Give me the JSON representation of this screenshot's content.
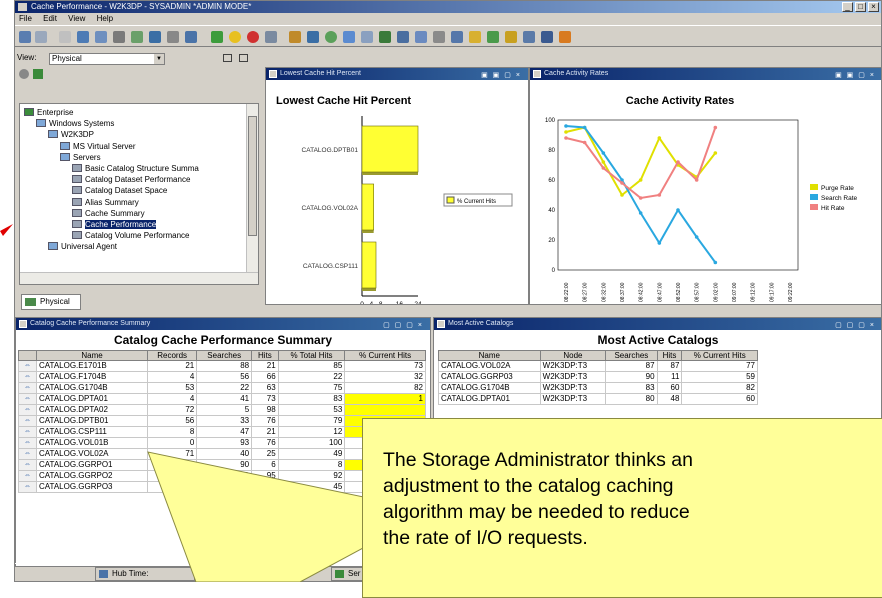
{
  "window": {
    "title": "Cache Performance - W2K3DP - SYSADMIN *ADMIN MODE*",
    "controls": [
      "_",
      "□",
      "×"
    ]
  },
  "menu": [
    "File",
    "Edit",
    "View",
    "Help"
  ],
  "navigator": {
    "view_label": "View:",
    "view_value": "Physical",
    "tab_label": "Physical",
    "tree": [
      {
        "label": "Enterprise",
        "depth": 0,
        "icon": "enterprise-icon"
      },
      {
        "label": "Windows Systems",
        "depth": 1,
        "icon": "folder-icon"
      },
      {
        "label": "W2K3DP",
        "depth": 2,
        "icon": "computer-icon"
      },
      {
        "label": "MS Virtual Server",
        "depth": 3,
        "icon": "agent-icon"
      },
      {
        "label": "Servers",
        "depth": 3,
        "icon": "agent-icon"
      },
      {
        "label": "Basic Catalog Structure Summa",
        "depth": 4,
        "icon": "workspace-icon"
      },
      {
        "label": "Catalog Dataset Performance",
        "depth": 4,
        "icon": "workspace-icon"
      },
      {
        "label": "Catalog Dataset Space",
        "depth": 4,
        "icon": "workspace-icon"
      },
      {
        "label": "Alias Summary",
        "depth": 4,
        "icon": "workspace-icon"
      },
      {
        "label": "Cache Summary",
        "depth": 4,
        "icon": "workspace-icon"
      },
      {
        "label": "Cache Performance",
        "depth": 4,
        "icon": "workspace-icon",
        "selected": true
      },
      {
        "label": "Catalog Volume Performance",
        "depth": 4,
        "icon": "workspace-icon"
      },
      {
        "label": "Universal Agent",
        "depth": 2,
        "icon": "agent-icon"
      }
    ]
  },
  "hit_panel": {
    "window_title": "Lowest Cache Hit Percent"
  },
  "rates_panel": {
    "window_title": "Cache Activity Rates"
  },
  "chart_data": [
    {
      "type": "bar",
      "title": "Lowest Cache Hit Percent",
      "categories": [
        "CATALOG.DPTB01",
        "CATALOG.VOL02A",
        "CATALOG.CSP111"
      ],
      "series": [
        {
          "name": "% Current Hits",
          "values": [
            24,
            5,
            6
          ]
        }
      ],
      "x_ticks": [
        "0",
        "4",
        "8",
        "16",
        "24"
      ],
      "xlim": [
        0,
        24
      ],
      "orientation": "horizontal",
      "color": "#ffff33"
    },
    {
      "type": "line",
      "title": "Cache Activity Rates",
      "x": [
        "08:22:00",
        "08:27:00",
        "08:32:00",
        "08:37:00",
        "08:42:00",
        "08:47:00",
        "08:52:00",
        "08:57:00",
        "09:02:00",
        "09:07:00",
        "09:12:00",
        "09:17:00",
        "09:22:00"
      ],
      "ylim": [
        0,
        100
      ],
      "y_ticks": [
        0,
        20,
        40,
        60,
        80,
        100
      ],
      "series": [
        {
          "name": "Purge Rate",
          "color": "#e0e000",
          "values": [
            92,
            95,
            72,
            50,
            60,
            88,
            70,
            62,
            78,
            null,
            null,
            null,
            null
          ]
        },
        {
          "name": "Search Rate",
          "color": "#2aa8e0",
          "values": [
            96,
            95,
            78,
            60,
            38,
            18,
            40,
            22,
            5,
            null,
            null,
            null,
            null
          ]
        },
        {
          "name": "Hit Rate",
          "color": "#f08080",
          "values": [
            88,
            85,
            68,
            58,
            48,
            50,
            72,
            60,
            95,
            null,
            null,
            null,
            null
          ]
        }
      ],
      "legend_position": "right",
      "grid": false
    }
  ],
  "summary_panel": {
    "window_title": "Catalog Cache Performance Summary",
    "heading": "Catalog Cache Performance Summary",
    "columns": [
      "Name",
      "Records",
      "Searches",
      "Hits",
      "% Total Hits",
      "% Current Hits"
    ],
    "rows": [
      [
        "CATALOG.E1701B",
        "21",
        "88",
        "21",
        "85",
        "73"
      ],
      [
        "CATALOG.F1704B",
        "4",
        "56",
        "66",
        "22",
        "32"
      ],
      [
        "CATALOG.G1704B",
        "53",
        "22",
        "63",
        "75",
        "82"
      ],
      [
        "CATALOG.DPTA01",
        "4",
        "41",
        "73",
        "83",
        "1"
      ],
      [
        "CATALOG.DPTA02",
        "72",
        "5",
        "98",
        "53",
        ""
      ],
      [
        "CATALOG.DPTB01",
        "56",
        "33",
        "76",
        "79",
        ""
      ],
      [
        "CATALOG.CSP111",
        "8",
        "47",
        "21",
        "12",
        ""
      ],
      [
        "CATALOG.VOL01B",
        "0",
        "93",
        "76",
        "100",
        ""
      ],
      [
        "CATALOG.VOL02A",
        "71",
        "40",
        "25",
        "49",
        ""
      ],
      [
        "CATALOG.GGRPO1",
        "1",
        "90",
        "6",
        "8",
        ""
      ],
      [
        "CATALOG.GGRPO2",
        "",
        "51",
        "95",
        "92",
        ""
      ],
      [
        "CATALOG.GGRPO3",
        "",
        "6",
        "60",
        "45",
        ""
      ]
    ],
    "highlight_rows": [
      3,
      4,
      5,
      6,
      9
    ]
  },
  "active_panel": {
    "window_title": "Most Active Catalogs",
    "heading": "Most Active Catalogs",
    "columns": [
      "Name",
      "Node",
      "Searches",
      "Hits",
      "% Current Hits"
    ],
    "rows": [
      [
        "CATALOG.VOL02A",
        "W2K3DP:T3",
        "87",
        "87",
        "77"
      ],
      [
        "CATALOG.GGRP03",
        "W2K3DP:T3",
        "90",
        "11",
        "59"
      ],
      [
        "CATALOG.G1704B",
        "W2K3DP:T3",
        "83",
        "60",
        "82"
      ],
      [
        "CATALOG.DPTA01",
        "W2K3DP:T3",
        "80",
        "48",
        "60"
      ]
    ]
  },
  "statusbar": {
    "hub_label": "Hub Time:",
    "server_label": "Ser"
  },
  "callout": {
    "lines": [
      "The Storage Administrator thinks an",
      "adjustment to the catalog caching",
      "algorithm may be needed to reduce",
      "the rate of I/O requests."
    ]
  },
  "colors": {
    "bar": "#ffff33",
    "callout": "#ffff99",
    "panel_title": "#0a246a",
    "arrow": "#e00000"
  }
}
